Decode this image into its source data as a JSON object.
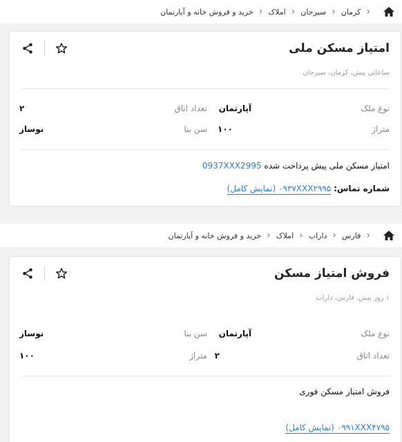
{
  "listings": [
    {
      "breadcrumb": [
        "کرمان",
        "سیرجان",
        "املاک",
        "خرید و فروش خانه و آپارتمان"
      ],
      "title": "امتیاز مسکن ملی",
      "subtitle": "ساعاتی پیش، کرمان، سیرجان",
      "details": [
        {
          "label": "نوع ملک",
          "value": "آپارتمان"
        },
        {
          "label": "تعداد اتاق",
          "value": "۲"
        },
        {
          "label": "متراژ",
          "value": "۱۰۰"
        },
        {
          "label": "سن بنا",
          "value": "نوساز"
        }
      ],
      "description_text": "امتیاز مسکن ملی پیش پرداخت شده",
      "description_phone": "0937XXX2995",
      "contact_label": "شماره تماس:",
      "contact_value": "۰۹۳۷XXX۲۹۹۵ (نمایش کامل)"
    },
    {
      "breadcrumb": [
        "فارس",
        "داراب",
        "املاک",
        "خرید و فروش خانه و آپارتمان"
      ],
      "title": "فروش امتیاز مسکن",
      "subtitle": "۱ روز پیش، فارس، داراب",
      "details": [
        {
          "label": "نوع ملک",
          "value": "آپارتمان"
        },
        {
          "label": "سن بنا",
          "value": "نوساز"
        },
        {
          "label": "تعداد اتاق",
          "value": "۲"
        },
        {
          "label": "متراژ",
          "value": "۱۰۰"
        }
      ],
      "description_text": "فروش امتیاز مسکن فوری",
      "contact_value": "۰۹۹۱XXX۴۷۹۵ (نمایش کامل)"
    }
  ],
  "icons": {
    "home": "home-icon",
    "share": "share-icon",
    "star": "star-icon",
    "chevron": "chevron-left-icon"
  },
  "colors": {
    "link": "#2a7fd4",
    "muted": "#888888"
  }
}
